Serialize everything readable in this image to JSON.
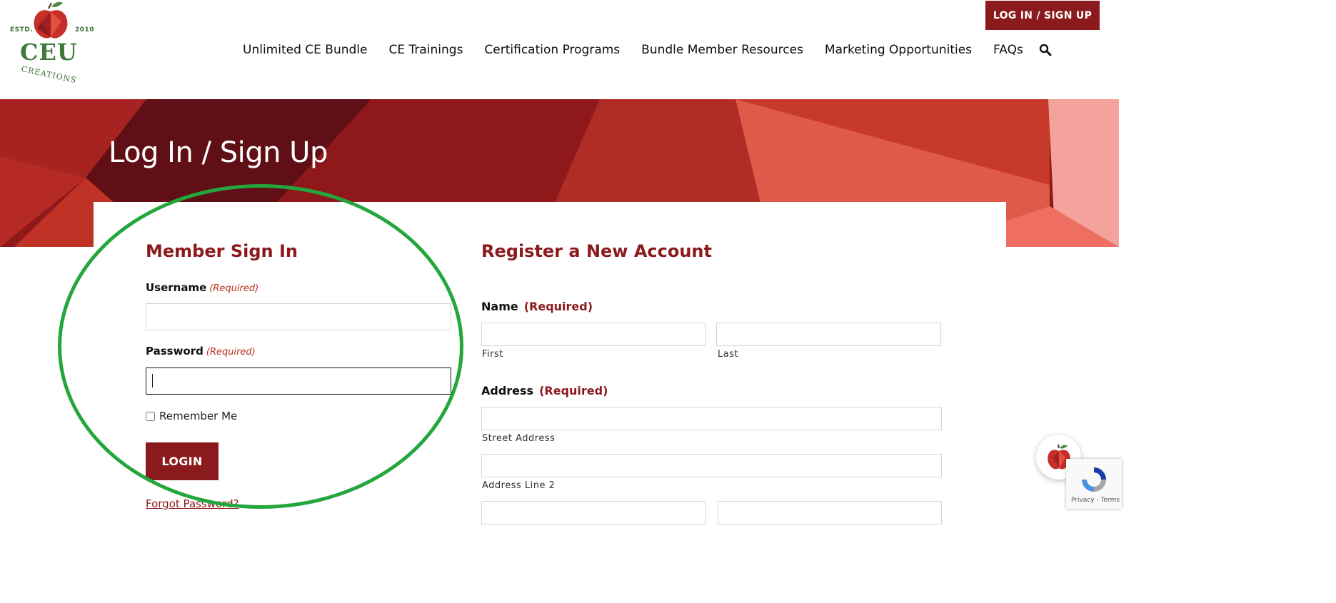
{
  "brand": {
    "estd": "ESTD.",
    "year": "2010",
    "name": "CEU",
    "tagline": "CREATIONS",
    "colors": {
      "primary": "#8b1a1d",
      "green": "#3f7a3a",
      "highlight": "#23a63c"
    }
  },
  "header": {
    "login_button": "LOG IN / SIGN UP",
    "nav": [
      "Unlimited CE Bundle",
      "CE Trainings",
      "Certification Programs",
      "Bundle Member Resources",
      "Marketing Opportunities",
      "FAQs"
    ],
    "search_icon": "search-icon"
  },
  "hero": {
    "title": "Log In / Sign Up"
  },
  "signin": {
    "title": "Member Sign In",
    "username_label": "Username",
    "password_label": "Password",
    "required": "(Required)",
    "username_value": "",
    "password_value": "",
    "remember_label": "Remember Me",
    "remember_checked": false,
    "login_button": "LOGIN",
    "forgot_link": "Forgot Password?"
  },
  "register": {
    "title": "Register a New Account",
    "name_label": "Name",
    "address_label": "Address",
    "required": "(Required)",
    "first_sub": "First",
    "last_sub": "Last",
    "street_sub": "Street Address",
    "line2_sub": "Address Line 2"
  },
  "recaptcha": {
    "text": "Privacy - Terms"
  }
}
